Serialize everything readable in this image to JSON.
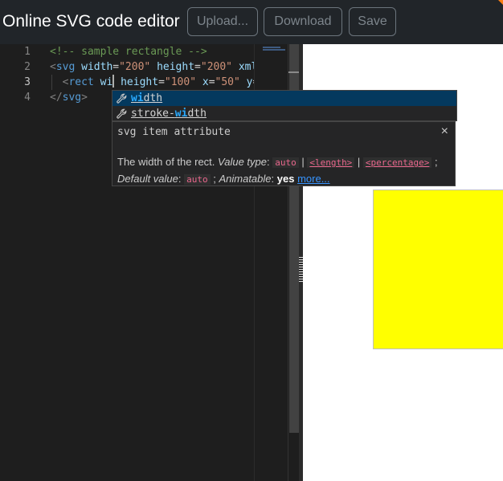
{
  "header": {
    "title": "Online SVG code editor",
    "upload_label": "Upload...",
    "download_label": "Download",
    "save_label": "Save"
  },
  "editor": {
    "line_numbers": [
      "1",
      "2",
      "3",
      "4"
    ],
    "lines": {
      "l1": {
        "comment": "<!-- sample rectangle -->"
      },
      "l2": {
        "open": "<",
        "tag": "svg",
        "attr1": " width",
        "eq1": "=",
        "val1": "\"200\"",
        "attr2": " height",
        "eq2": "=",
        "val2": "\"200\"",
        "attr3": " xml"
      },
      "l3": {
        "indent": "  ",
        "open": "<",
        "tag": "rect",
        "typed": " wi",
        "attr1": " height",
        "eq1": "=",
        "val1": "\"100\"",
        "attr2": " x",
        "eq2": "=",
        "val2": "\"50\"",
        "attr3": " y",
        "eq3": "="
      },
      "l4": {
        "open": "</",
        "tag": "svg",
        "close": ">"
      }
    }
  },
  "suggest": {
    "items": [
      {
        "match": "wi",
        "rest": "dth"
      },
      {
        "pre": "stroke-",
        "match": "wi",
        "rest": "dth"
      }
    ]
  },
  "details": {
    "title": "svg item attribute",
    "close": "×",
    "desc": "The width of the rect.",
    "value_type_label": "Value type",
    "kw_auto": "auto",
    "kw_length": "<length>",
    "kw_percentage": "<percentage>",
    "default_label": "Default value",
    "default_value": "auto",
    "animatable_label": "Animatable",
    "animatable_value": "yes",
    "more_link": "more..."
  },
  "colors": {
    "header_bg": "#212529",
    "editor_bg": "#1e1e1e",
    "rect_fill": "#ffff00",
    "selection": "#04395e",
    "match_highlight": "#2aaaff"
  }
}
